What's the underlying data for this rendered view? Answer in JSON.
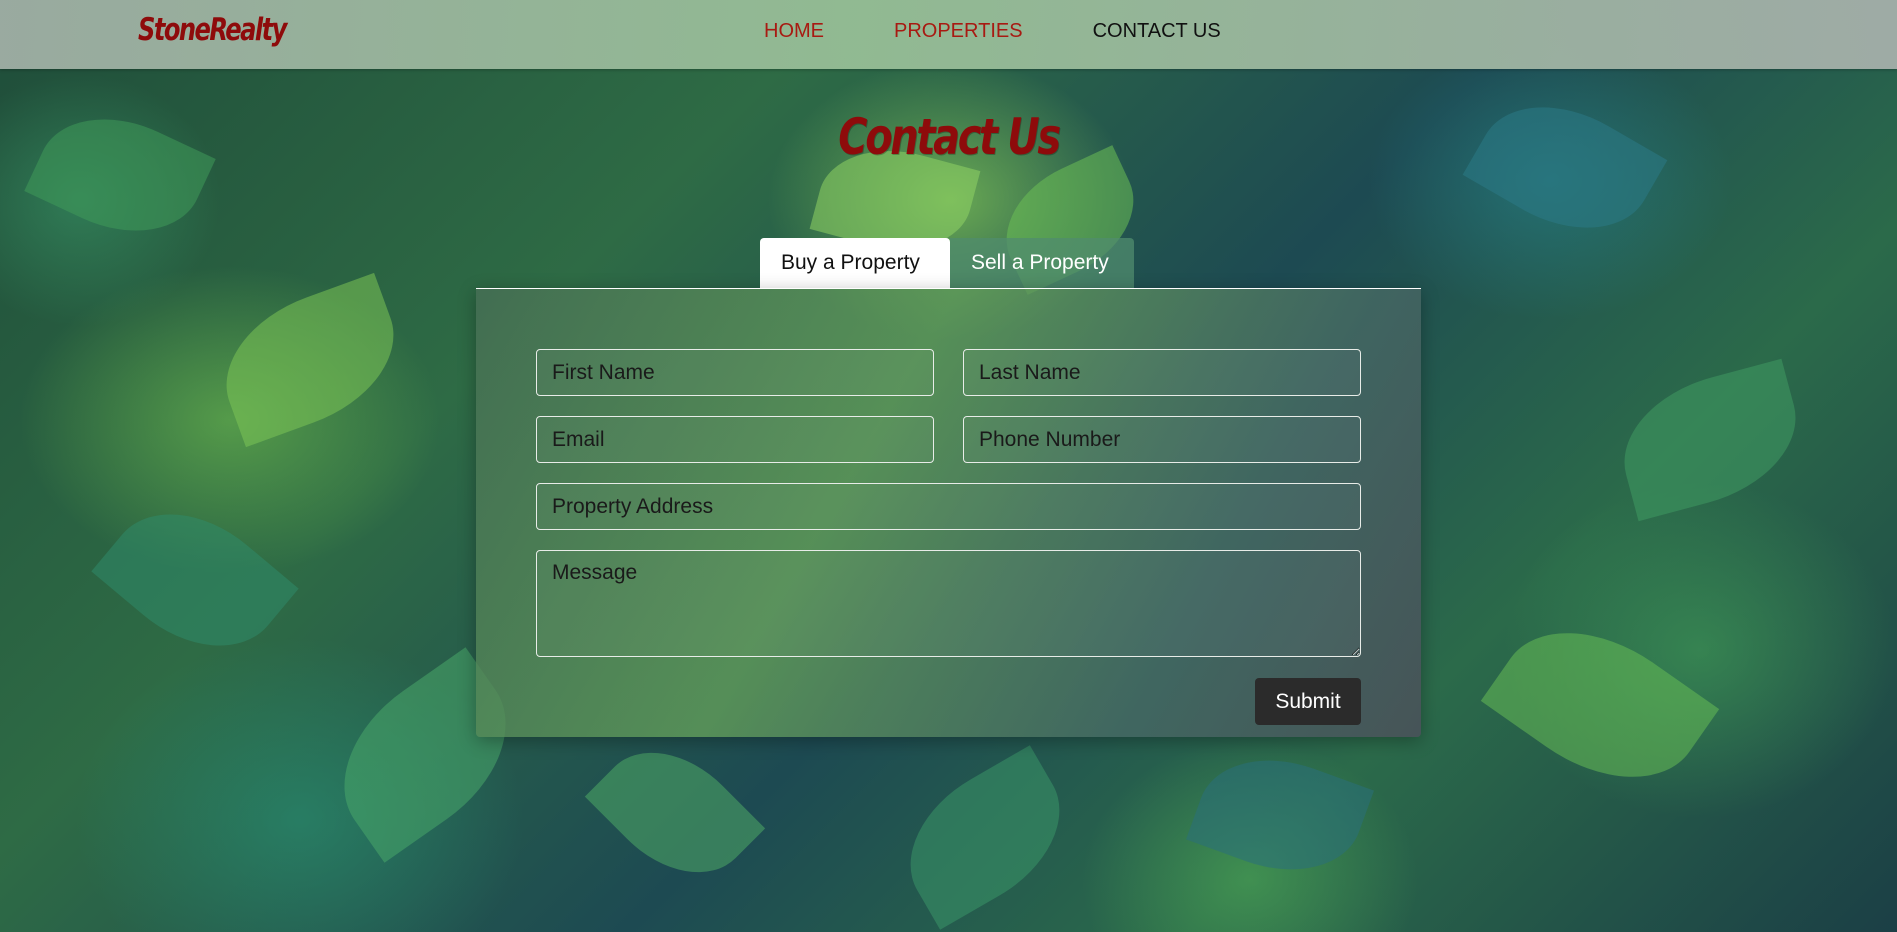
{
  "brand": {
    "logo_text": "StoneRealty"
  },
  "nav": {
    "items": [
      {
        "label": "HOME"
      },
      {
        "label": "PROPERTIES"
      },
      {
        "label": "CONTACT US"
      }
    ]
  },
  "page": {
    "heading": "Contact Us"
  },
  "tabs": [
    {
      "label": "Buy a Property",
      "active": true
    },
    {
      "label": "Sell a Property",
      "active": false
    }
  ],
  "form": {
    "first_name": {
      "placeholder": "First Name",
      "value": ""
    },
    "last_name": {
      "placeholder": "Last Name",
      "value": ""
    },
    "email": {
      "placeholder": "Email",
      "value": ""
    },
    "phone": {
      "placeholder": "Phone Number",
      "value": ""
    },
    "address": {
      "placeholder": "Property Address",
      "value": ""
    },
    "message": {
      "placeholder": "Message",
      "value": ""
    },
    "submit_label": "Submit"
  },
  "colors": {
    "brand_red": "#8e0b0b",
    "nav_active_red": "#a81a12",
    "submit_bg": "#2b2b2b"
  }
}
